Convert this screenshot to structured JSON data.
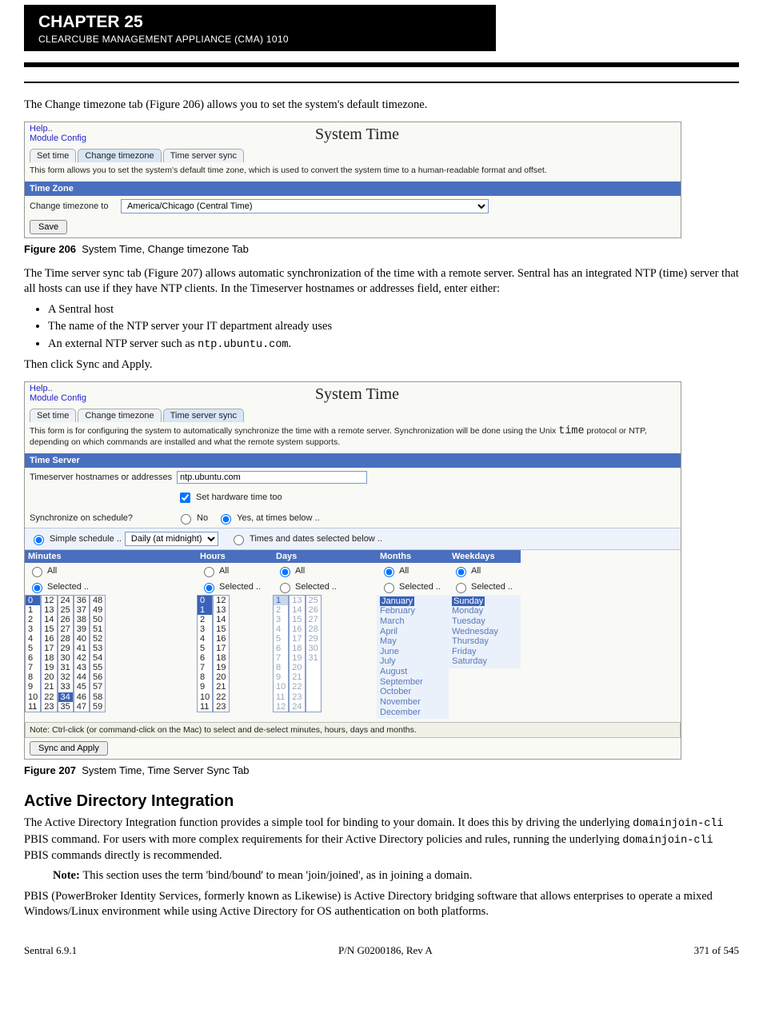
{
  "header": {
    "chapter": "CHAPTER 25",
    "subtitle": "CLEARCUBE MANAGEMENT APPLIANCE (CMA) 1010"
  },
  "intro1": "The Change timezone tab (Figure 206) allows you to set the system's default timezone.",
  "shot1": {
    "help": "Help..",
    "module": "Module Config",
    "title": "System Time",
    "tabs": {
      "set": "Set time",
      "tz": "Change timezone",
      "sync": "Time server sync"
    },
    "desc": "This form allows you to set the system's default time zone, which is used to convert the system time to a human-readable format and offset.",
    "barTitle": "Time Zone",
    "rowLabel": "Change timezone to",
    "tzValue": "America/Chicago (Central Time)",
    "save": "Save"
  },
  "cap1": {
    "lead": "Figure 206",
    "rest": "System Time, Change timezone Tab"
  },
  "para2": "The Time server sync tab (Figure 207) allows automatic synchronization of the time with a remote server. Sentral has an integrated NTP (time) server that all hosts can use if they have NTP clients. In the Timeserver hostnames or addresses field, enter either:",
  "bullets": [
    "A Sentral host",
    "The name of the NTP server your IT department already uses",
    "An external NTP server such as "
  ],
  "ntpHost": "ntp.ubuntu.com",
  "para3": "Then click Sync and Apply.",
  "shot2": {
    "help": "Help..",
    "module": "Module Config",
    "title": "System Time",
    "tabs": {
      "set": "Set time",
      "tz": "Change timezone",
      "sync": "Time server sync"
    },
    "desc_a": "This form is for configuring the system to automatically synchronize the time with a remote server. Synchronization will be done using the Unix ",
    "desc_code": "time",
    "desc_b": " protocol or NTP, depending on which commands are installed and what the remote system supports.",
    "barTitle": "Time Server",
    "hostLabel": "Timeserver hostnames or addresses",
    "hostValue": "ntp.ubuntu.com",
    "hw": "Set hardware time too",
    "schedQ": "Synchronize on schedule?",
    "no": "No",
    "yes": "Yes, at times below ..",
    "simple": "Simple schedule ..",
    "simpleSel": "Daily (at midnight)",
    "timesSel": "Times and dates selected below ..",
    "cols": {
      "min": "Minutes",
      "hr": "Hours",
      "day": "Days",
      "mo": "Months",
      "wk": "Weekdays"
    },
    "all": "All",
    "sel": "Selected ..",
    "months": [
      "January",
      "February",
      "March",
      "April",
      "May",
      "June",
      "July",
      "August",
      "September",
      "October",
      "November",
      "December"
    ],
    "week": [
      "Sunday",
      "Monday",
      "Tuesday",
      "Wednesday",
      "Thursday",
      "Friday",
      "Saturday"
    ],
    "note": "Note: Ctrl-click (or command-click on the Mac) to select and de-select minutes, hours, days and months.",
    "apply": "Sync and Apply"
  },
  "cap2": {
    "lead": "Figure 207",
    "rest": "System Time, Time Server Sync Tab"
  },
  "secTitle": "Active Directory Integration",
  "secP1a": "The Active Directory Integration function provides a simple tool for binding to your domain. It does this by driving the underlying",
  "secP1b": "PBIS command. For users with more complex requirements for their Active Directory policies and rules, running the underlying",
  "secP1c": "PBIS commands directly is recommended.",
  "note2": "This section uses the term 'bind/bound' to mean 'join/joined', as in joining a domain.",
  "secP2": "PBIS (PowerBroker Identity Services, formerly known as Likewise) is Active Directory bridging software that allows enterprises to operate a mixed Windows/Linux environment while using Active Directory for OS authentication on both platforms.",
  "footer": {
    "left": "Sentral 6.9.1",
    "center": "P/N G0200186, Rev A",
    "right": "371 of 545"
  }
}
